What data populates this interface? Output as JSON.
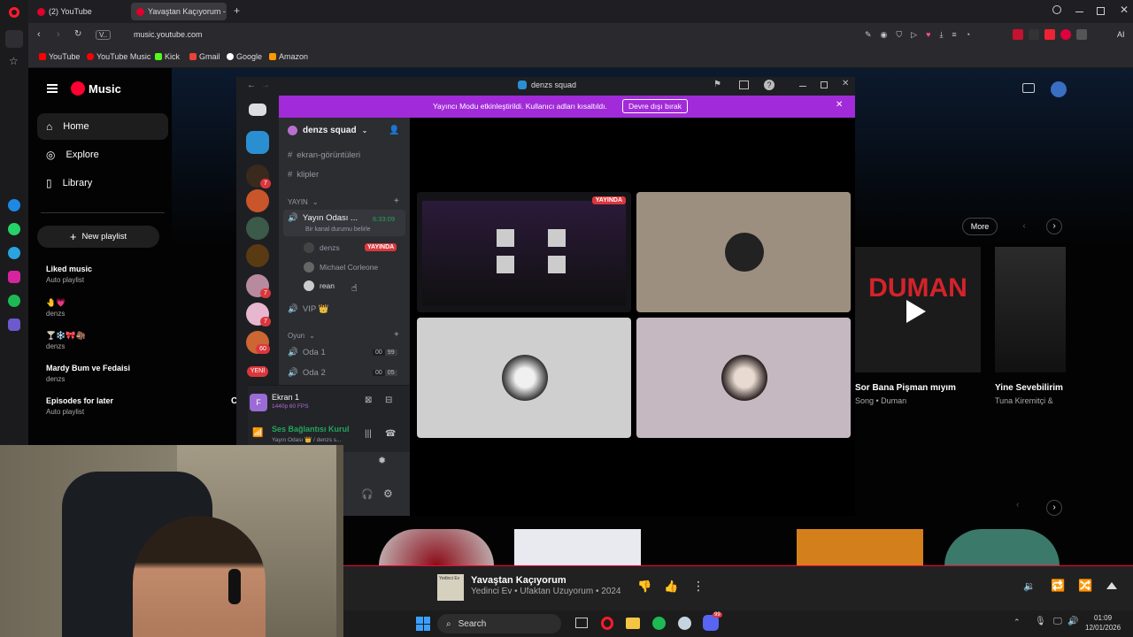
{
  "browser": {
    "tabs": [
      {
        "label": "(2) YouTube"
      },
      {
        "label": "Yavaştan Kaçıyorum -"
      }
    ],
    "tab_add": "+",
    "url": "music.youtube.com",
    "url_badge": "V..",
    "bookmarks": [
      "YouTube",
      "YouTube Music",
      "Kick",
      "Gmail",
      "Google",
      "Amazon"
    ],
    "ai_label": "AI"
  },
  "ytm": {
    "logo_text": "Music",
    "nav": [
      {
        "label": "Home",
        "icon": "home-icon"
      },
      {
        "label": "Explore",
        "icon": "compass-icon"
      },
      {
        "label": "Library",
        "icon": "library-icon"
      }
    ],
    "new_playlist": "New playlist",
    "playlists": [
      {
        "title": "Liked music",
        "sub": "Auto playlist"
      },
      {
        "title": "🤚💗",
        "sub": "denzs"
      },
      {
        "title": "🍸❄️🎀🦣",
        "sub": "denzs"
      },
      {
        "title": "Mardy Bum ve Fedaisi",
        "sub": "denzs"
      },
      {
        "title": "Episodes for later",
        "sub": "Auto playlist"
      }
    ],
    "more_button": "More",
    "cards": [
      {
        "banner": "DUMAN",
        "title": "Sor Bana Pişman mıyım",
        "sub": "Song • Duman"
      },
      {
        "title": "Yine Sevebilirim",
        "sub": "Tuna Kiremitçi &"
      }
    ],
    "partial_title_fragment": "C"
  },
  "discord": {
    "window_title": "denzs squad",
    "banner_text": "Yayıncı Modu etkinleştirildi. Kullanıcı adları kısaltıldı.",
    "banner_button": "Devre dışı bırak",
    "server_name": "denzs squad",
    "badge_numbers": [
      "7",
      "7",
      "7",
      "60"
    ],
    "new_badge": "YENİ",
    "channels_top": [
      "ekran-görüntüleri",
      "klipler"
    ],
    "category_stream": "YAYIN",
    "voice_channel": {
      "name": "Yayın Odası ...",
      "time": "6:33:09",
      "status": "Bir kanal durumu belirle"
    },
    "voice_users": [
      {
        "name": "denzs",
        "badge": "YAYINDA"
      },
      {
        "name": "Michael Corleone",
        "badge": ""
      },
      {
        "name": "rean",
        "badge": ""
      }
    ],
    "vip_channel": "VIP 👑",
    "category_game": "Oyun",
    "game_channels": [
      {
        "name": "Oda 1",
        "a": "00",
        "b": "99"
      },
      {
        "name": "Oda 2",
        "a": "00",
        "b": "05"
      }
    ],
    "screen_share": {
      "title": "Ekran 1",
      "sub": "1440p 60 FPS"
    },
    "voice_connected": {
      "title": "Ses Bağlantısı Kurul",
      "sub": "Yayın Odası 👑 / denzs s..."
    },
    "live_badge": "YAYINDA"
  },
  "player": {
    "title": "Yavaştan Kaçıyorum",
    "subtitle": "Yedinci Ev • Ufaktan Uzuyorum • 2024",
    "art_text": "Yedinci Ev",
    "more_glyph": "⋮"
  },
  "taskbar": {
    "search": "Search",
    "time": "01:09",
    "date": "12/01/2026",
    "discord_badge": "99"
  },
  "colors": {
    "yt_red": "#ff0033",
    "discord_purple": "#a12bd8",
    "discord_live": "#da373c",
    "discord_green": "#23a55a"
  }
}
